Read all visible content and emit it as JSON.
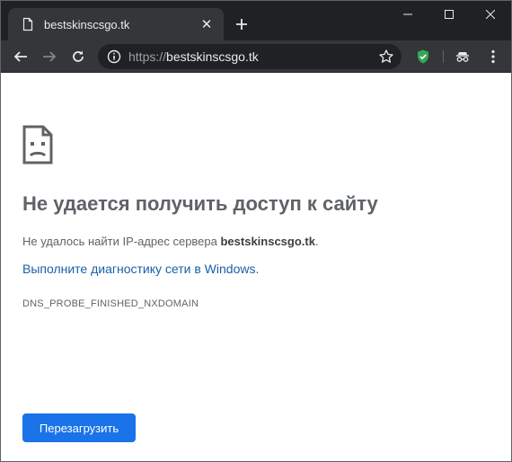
{
  "tab": {
    "title": "bestskinscsgo.tk",
    "close_glyph": "✕"
  },
  "toolbar": {
    "url_scheme": "https://",
    "url_host": "bestskinscsgo.tk"
  },
  "error_page": {
    "heading": "Не удается получить доступ к сайту",
    "description_prefix": "Не удалось найти IP-адрес сервера ",
    "description_host": "bestskinscsgo.tk",
    "description_suffix": ".",
    "diagnostics_link": "Выполните диагностику сети в Windows.",
    "error_code": "DNS_PROBE_FINISHED_NXDOMAIN",
    "reload_button": "Перезагрузить"
  },
  "icons": {
    "tab_favicon": "document-icon",
    "new_tab": "plus-icon",
    "minimize": "minimize-icon",
    "maximize": "maximize-icon",
    "close": "close-icon",
    "back": "arrow-left-icon",
    "forward": "arrow-right-icon",
    "reload": "reload-icon",
    "site_info": "info-icon",
    "bookmark": "star-icon",
    "extension": "shield-check-icon",
    "incognito": "incognito-icon",
    "menu": "kebab-menu-icon",
    "error": "sad-document-icon"
  },
  "colors": {
    "titlebar": "#202124",
    "toolbar": "#35363a",
    "link": "#1a5fa8",
    "button": "#1a73e8",
    "shield": "#34a853"
  }
}
